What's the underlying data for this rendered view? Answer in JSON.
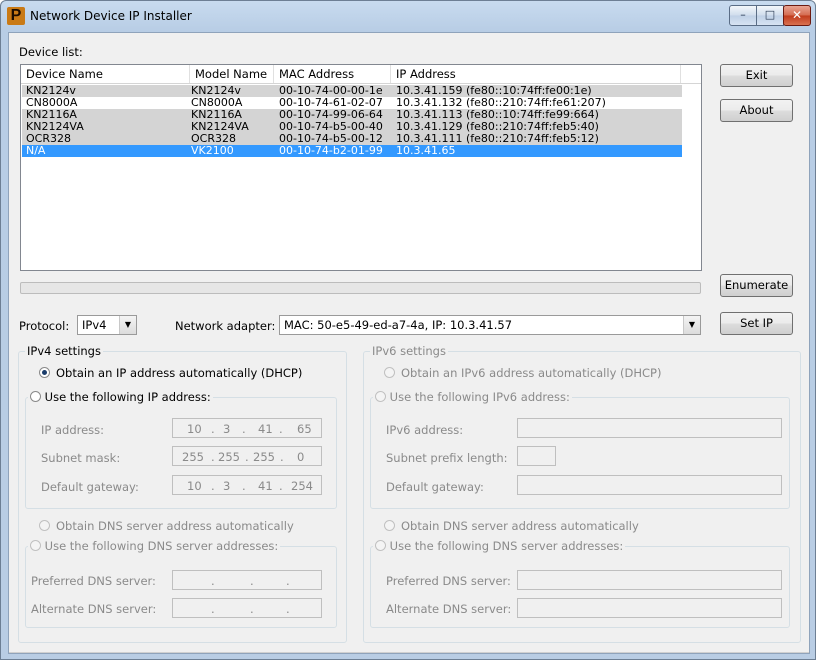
{
  "window": {
    "title": "Network Device IP Installer",
    "min": "–",
    "max": "□",
    "close": "✕"
  },
  "device_list": {
    "label": "Device list:",
    "columns": [
      "Device Name",
      "Model Name",
      "MAC Address",
      "IP Address"
    ],
    "rows": [
      {
        "device": "KN2124v",
        "model": "KN2124v",
        "mac": "00-10-74-00-00-1e",
        "ip": "10.3.41.159 (fe80::10:74ff:fe00:1e)",
        "style": "gray"
      },
      {
        "device": "CN8000A",
        "model": "CN8000A",
        "mac": "00-10-74-61-02-07",
        "ip": "10.3.41.132 (fe80::210:74ff:fe61:207)",
        "style": "white"
      },
      {
        "device": "KN2116A",
        "model": "KN2116A",
        "mac": "00-10-74-99-06-64",
        "ip": "10.3.41.113 (fe80::10:74ff:fe99:664)",
        "style": "gray"
      },
      {
        "device": "KN2124VA",
        "model": "KN2124VA",
        "mac": "00-10-74-b5-00-40",
        "ip": "10.3.41.129 (fe80::210:74ff:feb5:40)",
        "style": "gray"
      },
      {
        "device": "OCR328",
        "model": "OCR328",
        "mac": "00-10-74-b5-00-12",
        "ip": "10.3.41.111 (fe80::210:74ff:feb5:12)",
        "style": "gray"
      },
      {
        "device": "N/A",
        "model": "VK2100",
        "mac": "00-10-74-b2-01-99",
        "ip": "10.3.41.65",
        "style": "selected"
      }
    ]
  },
  "buttons": {
    "exit": "Exit",
    "about": "About",
    "enumerate": "Enumerate",
    "set_ip": "Set IP"
  },
  "protocol": {
    "label": "Protocol:",
    "value": "IPv4"
  },
  "adapter": {
    "label": "Network adapter:",
    "value": "MAC: 50-e5-49-ed-a7-4a,  IP: 10.3.41.57"
  },
  "ipv4": {
    "title": "IPv4 settings",
    "dhcp": "Obtain an IP address automatically (DHCP)",
    "manual": "Use the following IP address:",
    "ip_label": "IP address:",
    "ip": [
      "10",
      "3",
      "41",
      "65"
    ],
    "mask_label": "Subnet mask:",
    "mask": [
      "255",
      "255",
      "255",
      "0"
    ],
    "gw_label": "Default gateway:",
    "gw": [
      "10",
      "3",
      "41",
      "254"
    ],
    "dns_auto": "Obtain DNS server address automatically",
    "dns_manual": "Use the following DNS server addresses:",
    "pref_label": "Preferred DNS server:",
    "alt_label": "Alternate DNS server:",
    "dns_dot": "."
  },
  "ipv6": {
    "title": "IPv6 settings",
    "dhcp": "Obtain an IPv6 address automatically (DHCP)",
    "manual": "Use the following IPv6 address:",
    "ip_label": "IPv6 address:",
    "prefix_label": "Subnet prefix length:",
    "gw_label": "Default gateway:",
    "dns_auto": "Obtain DNS server address automatically",
    "dns_manual": "Use the following DNS server addresses:",
    "pref_label": "Preferred DNS server:",
    "alt_label": "Alternate DNS server:"
  },
  "colors": {
    "selection": "#3399ff",
    "gray_row": "#d4d4d4",
    "close_red": "#c03a1c"
  }
}
